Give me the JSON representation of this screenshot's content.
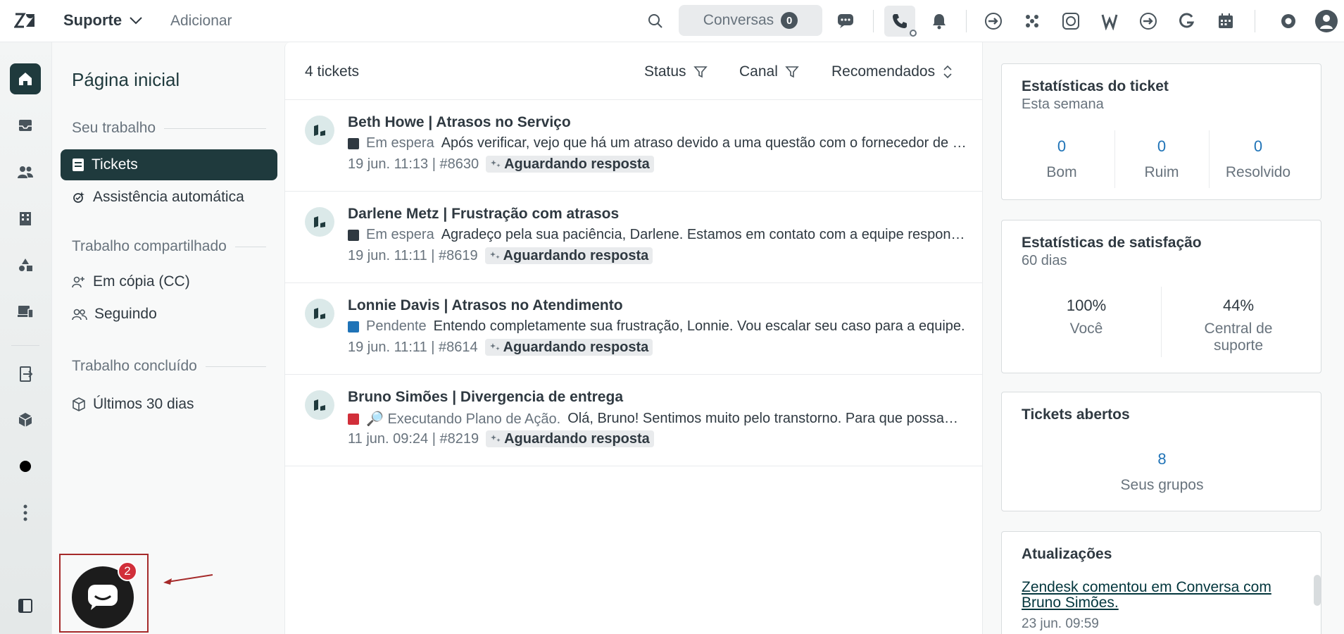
{
  "topbar": {
    "product": "Suporte",
    "add_label": "Adicionar",
    "conversations_label": "Conversas",
    "conversations_count": "0"
  },
  "nav": {
    "title": "Página inicial",
    "section_your_work": "Seu trabalho",
    "item_tickets": "Tickets",
    "item_auto_assist": "Assistência automática",
    "section_shared": "Trabalho compartilhado",
    "item_cc": "Em cópia (CC)",
    "item_following": "Seguindo",
    "section_done": "Trabalho concluído",
    "item_last30": "Últimos 30 dias"
  },
  "list": {
    "count": "4 tickets",
    "filter_status": "Status",
    "filter_channel": "Canal",
    "sort": "Recomendados",
    "tickets": [
      {
        "title": "Beth Howe | Atrasos no Serviço",
        "status": "Em espera",
        "status_color": "#2f3941",
        "preview": "Após verificar, vejo que há um atraso devido a uma questão com o fornecedor de logística.",
        "meta": "19 jun. 11:13 | #8630",
        "tag": "Aguardando resposta"
      },
      {
        "title": "Darlene Metz | Frustração com atrasos",
        "status": "Em espera",
        "status_color": "#2f3941",
        "preview": "Agradeço pela sua paciência, Darlene. Estamos em contato com a equipe responsável.",
        "meta": "19 jun. 11:11 | #8619",
        "tag": "Aguardando resposta"
      },
      {
        "title": "Lonnie Davis | Atrasos no Atendimento",
        "status": "Pendente",
        "status_color": "#1f73b7",
        "preview": "Entendo completamente sua frustração, Lonnie. Vou escalar seu caso para a equipe.",
        "meta": "19 jun. 11:11 | #8614",
        "tag": "Aguardando resposta"
      },
      {
        "title": "Bruno Simões | Divergencia de entrega",
        "status": "🔎 Executando Plano de Ação.",
        "status_color": "#d12f3a",
        "preview": "Olá, Bruno! Sentimos muito pelo transtorno. Para que possamos resolver sua questão rapidamente.",
        "meta": "11 jun. 09:24 | #8219",
        "tag": "Aguardando resposta"
      }
    ]
  },
  "stats_ticket": {
    "title": "Estatísticas do ticket",
    "subtitle": "Esta semana",
    "good_value": "0",
    "good_label": "Bom",
    "bad_value": "0",
    "bad_label": "Ruim",
    "solved_value": "0",
    "solved_label": "Resolvido"
  },
  "stats_satisfaction": {
    "title": "Estatísticas de satisfação",
    "subtitle": "60 dias",
    "you_value": "100%",
    "you_label": "Você",
    "center_value": "44%",
    "center_label": "Central de suporte"
  },
  "open_tickets": {
    "title": "Tickets abertos",
    "value": "8",
    "label": "Seus grupos"
  },
  "updates": {
    "title": "Atualizações",
    "link": "Zendesk comentou em Conversa com Bruno Simões.",
    "date": "23 jun. 09:59"
  },
  "chat_widget": {
    "badge": "2"
  },
  "colors": {
    "accent_dark": "#1f3a3d",
    "link_blue": "#1f73b7",
    "badge_red": "#d12f3a"
  }
}
